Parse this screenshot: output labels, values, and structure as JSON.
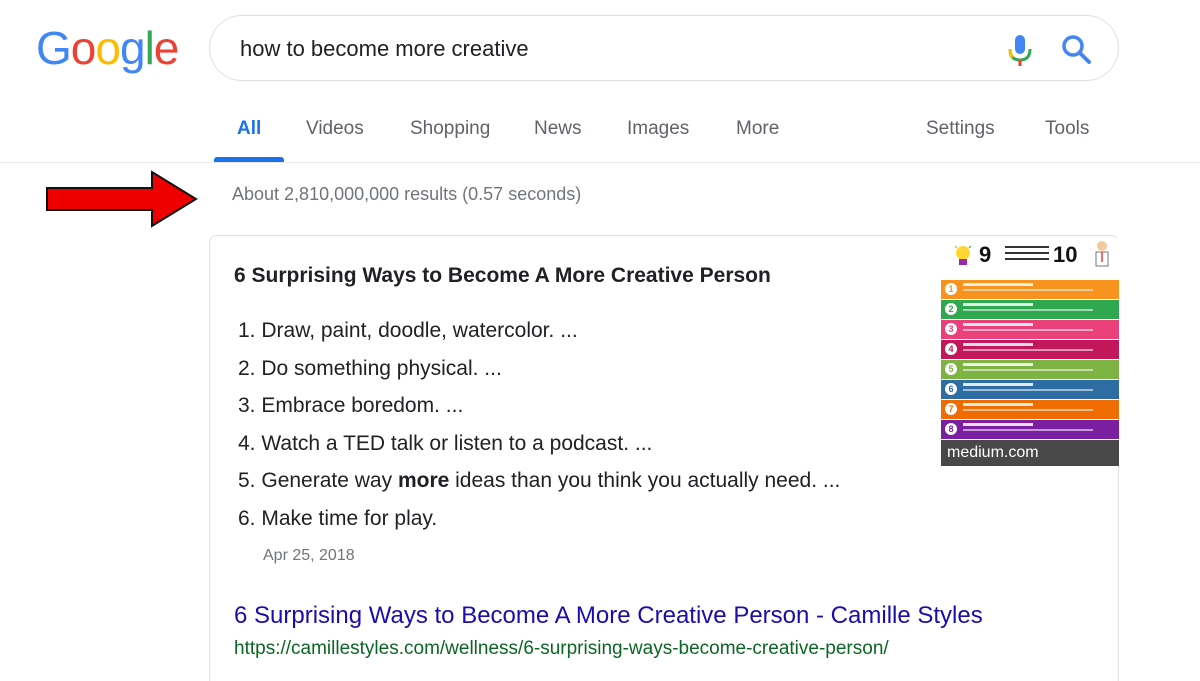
{
  "logo": {
    "letters": [
      "G",
      "o",
      "o",
      "g",
      "l",
      "e"
    ],
    "colors": [
      "#4285F4",
      "#EA4335",
      "#FBBC05",
      "#4285F4",
      "#34A853",
      "#EA4335"
    ]
  },
  "search": {
    "query": "how to become more creative",
    "mic_icon": "microphone-icon",
    "search_icon": "magnifier-icon"
  },
  "tabs": {
    "items": [
      "All",
      "Videos",
      "Shopping",
      "News",
      "Images",
      "More"
    ],
    "active": "All",
    "settings": "Settings",
    "tools": "Tools",
    "active_color": "#1a73e8"
  },
  "annotation": {
    "arrow_icon": "red-right-arrow-icon",
    "arrow_color": "#ee0000"
  },
  "result_stats": "About 2,810,000,000 results (0.57 seconds)",
  "snippet": {
    "title": "6 Surprising Ways to Become A More Creative Person",
    "items": [
      {
        "num": "1.",
        "pre": "Draw, paint, doodle, watercolor. ...",
        "bold": "",
        "post": ""
      },
      {
        "num": "2.",
        "pre": "Do something physical. ...",
        "bold": "",
        "post": ""
      },
      {
        "num": "3.",
        "pre": "Embrace boredom. ...",
        "bold": "",
        "post": ""
      },
      {
        "num": "4.",
        "pre": "Watch a TED talk or listen to a podcast. ...",
        "bold": "",
        "post": ""
      },
      {
        "num": "5.",
        "pre": "Generate way ",
        "bold": "more",
        "post": " ideas than you think you actually need. ..."
      },
      {
        "num": "6.",
        "pre": "Make time for play.",
        "bold": "",
        "post": ""
      }
    ],
    "date": "Apr 25, 2018",
    "link_title": "6 Surprising Ways to Become A More Creative Person - Camille Styles",
    "link_url": "https://camillestyles.com/wellness/6-surprising-ways-become-creative-person/",
    "link_color": "#1a0dab",
    "url_color": "#0b6623",
    "thumbnail": {
      "source": "medium.com",
      "number_left": "9",
      "number_right": "10",
      "band_colors": [
        "#f7931e",
        "#2fa84f",
        "#ec407a",
        "#c2185b",
        "#7cb342",
        "#2e6da4",
        "#ef6c00",
        "#7b1fa2"
      ],
      "band_numbers": [
        "1",
        "2",
        "3",
        "4",
        "5",
        "6",
        "7",
        "8"
      ]
    }
  }
}
